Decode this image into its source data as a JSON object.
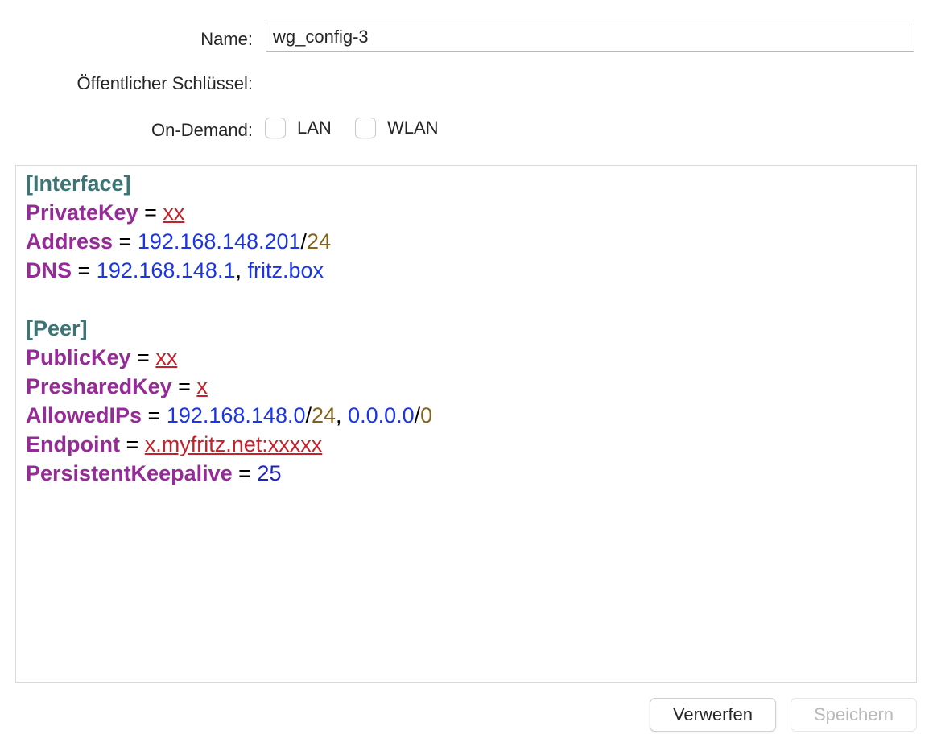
{
  "form": {
    "name_label": "Name:",
    "name_value": "wg_config-3",
    "pubkey_label": "Öffentlicher Schlüssel:",
    "pubkey_value": "",
    "ondemand_label": "On-Demand:",
    "ondemand_options": [
      {
        "label": "LAN",
        "checked": false
      },
      {
        "label": "WLAN",
        "checked": false
      }
    ]
  },
  "editor": {
    "lines": [
      {
        "tokens": [
          {
            "type": "section",
            "text": "[Interface]"
          }
        ]
      },
      {
        "tokens": [
          {
            "type": "key",
            "text": "PrivateKey"
          },
          {
            "type": "op",
            "text": " = "
          },
          {
            "type": "secret",
            "text": "xx"
          }
        ]
      },
      {
        "tokens": [
          {
            "type": "key",
            "text": "Address"
          },
          {
            "type": "op",
            "text": " = "
          },
          {
            "type": "ip",
            "text": "192.168.148.201"
          },
          {
            "type": "op",
            "text": "/"
          },
          {
            "type": "cidr",
            "text": "24"
          }
        ]
      },
      {
        "tokens": [
          {
            "type": "key",
            "text": "DNS"
          },
          {
            "type": "op",
            "text": " = "
          },
          {
            "type": "ip",
            "text": "192.168.148.1"
          },
          {
            "type": "op",
            "text": ", "
          },
          {
            "type": "host",
            "text": "fritz.box"
          }
        ]
      },
      {
        "tokens": []
      },
      {
        "tokens": [
          {
            "type": "section",
            "text": "[Peer]"
          }
        ]
      },
      {
        "tokens": [
          {
            "type": "key",
            "text": "PublicKey"
          },
          {
            "type": "op",
            "text": " = "
          },
          {
            "type": "secret",
            "text": "xx"
          }
        ]
      },
      {
        "tokens": [
          {
            "type": "key",
            "text": "PresharedKey"
          },
          {
            "type": "op",
            "text": " = "
          },
          {
            "type": "secret",
            "text": "x"
          }
        ]
      },
      {
        "tokens": [
          {
            "type": "key",
            "text": "AllowedIPs"
          },
          {
            "type": "op",
            "text": " = "
          },
          {
            "type": "ip",
            "text": "192.168.148.0"
          },
          {
            "type": "op",
            "text": "/"
          },
          {
            "type": "cidr",
            "text": "24"
          },
          {
            "type": "op",
            "text": ", "
          },
          {
            "type": "ip",
            "text": "0.0.0.0"
          },
          {
            "type": "op",
            "text": "/"
          },
          {
            "type": "cidr",
            "text": "0"
          }
        ]
      },
      {
        "tokens": [
          {
            "type": "key",
            "text": "Endpoint"
          },
          {
            "type": "op",
            "text": " = "
          },
          {
            "type": "secret",
            "text": "x.myfritz.net:xxxxx"
          }
        ]
      },
      {
        "tokens": [
          {
            "type": "key",
            "text": "PersistentKeepalive"
          },
          {
            "type": "op",
            "text": " = "
          },
          {
            "type": "num",
            "text": "25"
          }
        ]
      }
    ]
  },
  "buttons": {
    "discard_label": "Verwerfen",
    "save_label": "Speichern",
    "save_enabled": false
  },
  "colors": {
    "section": "#3b7575",
    "key": "#952b96",
    "ip": "#1a35e8",
    "cidr": "#856219",
    "secret": "#c4212a",
    "number": "#1d23c2",
    "disabled_text": "#b9b9b9"
  }
}
